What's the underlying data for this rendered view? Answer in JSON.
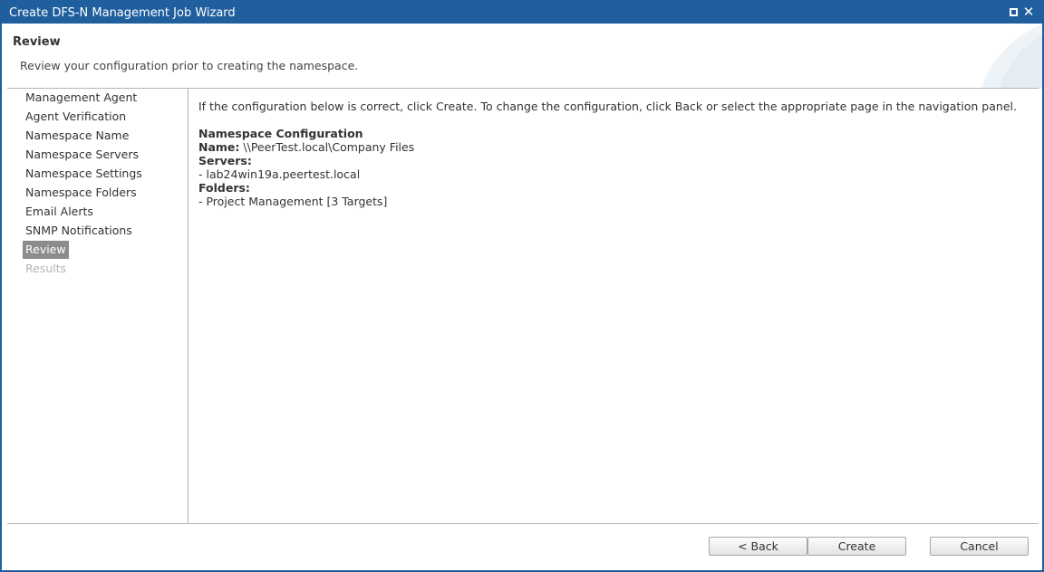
{
  "window": {
    "title": "Create DFS-N Management Job Wizard"
  },
  "header": {
    "title": "Review",
    "subtitle": "Review your configuration prior to creating the namespace."
  },
  "nav": {
    "items": [
      {
        "label": "Management Agent",
        "state": "normal"
      },
      {
        "label": "Agent Verification",
        "state": "normal"
      },
      {
        "label": "Namespace Name",
        "state": "normal"
      },
      {
        "label": "Namespace Servers",
        "state": "normal"
      },
      {
        "label": "Namespace Settings",
        "state": "normal"
      },
      {
        "label": "Namespace Folders",
        "state": "normal"
      },
      {
        "label": "Email Alerts",
        "state": "normal"
      },
      {
        "label": "SNMP Notifications",
        "state": "normal"
      },
      {
        "label": "Review",
        "state": "active"
      },
      {
        "label": "Results",
        "state": "disabled"
      }
    ]
  },
  "content": {
    "intro": "If the configuration below is correct, click Create. To change the configuration, click Back or select the appropriate page in the navigation panel.",
    "section_title": "Namespace Configuration",
    "name_label": "Name:",
    "name_value": "\\\\PeerTest.local\\Company Files",
    "servers_label": "Servers:",
    "servers": [
      "- lab24win19a.peertest.local"
    ],
    "folders_label": "Folders:",
    "folders": [
      "- Project Management [3 Targets]"
    ]
  },
  "buttons": {
    "back": "< Back",
    "create": "Create",
    "cancel": "Cancel"
  },
  "colors": {
    "titlebar": "#1f5f9e",
    "active_nav": "#8c8c8c",
    "disabled_text": "#b5b5b5"
  }
}
